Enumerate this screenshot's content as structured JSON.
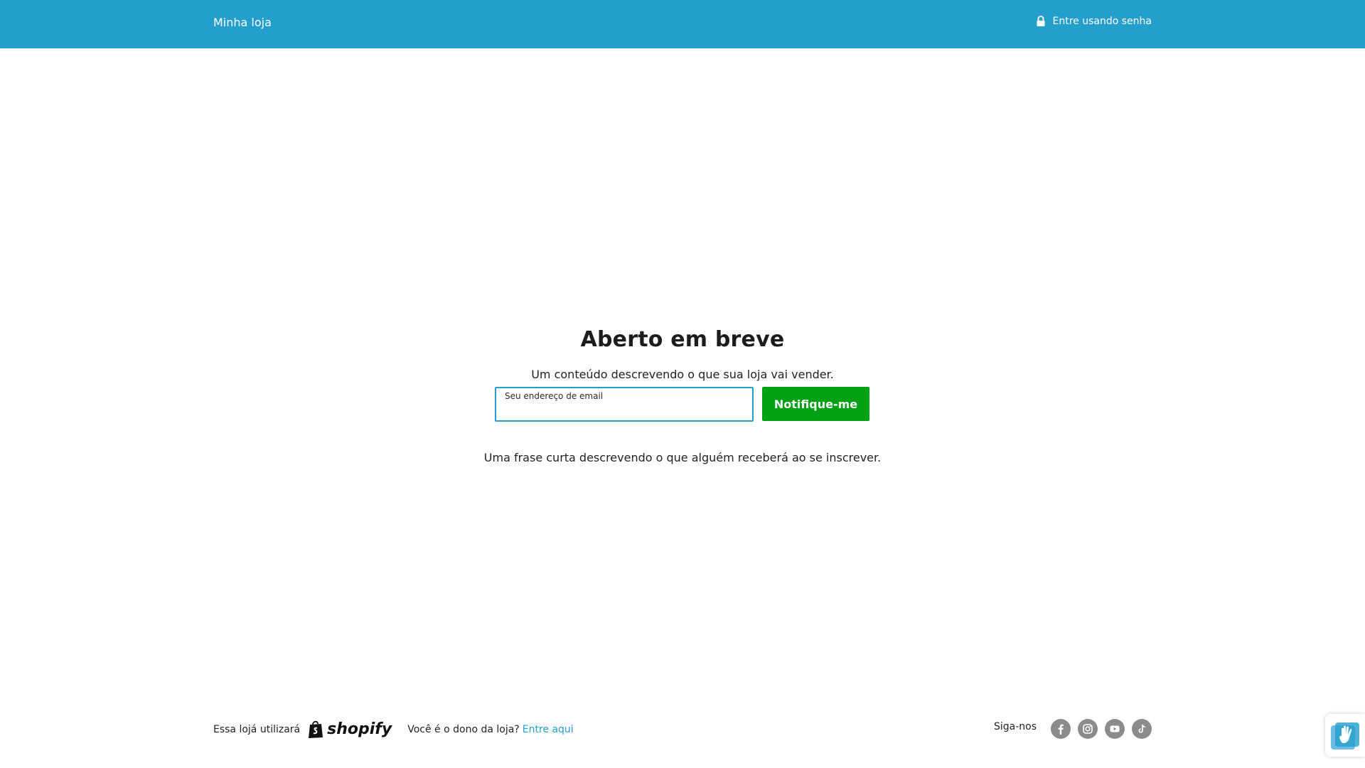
{
  "header": {
    "store_name": "Minha loja",
    "login_label": "Entre usando senha",
    "login_icon": "lock-icon"
  },
  "main": {
    "title": "Aberto em breve",
    "description": "Um conteúdo descrevendo o que sua loja vai vender.",
    "email_label": "Seu endereço de email",
    "email_value": "",
    "notify_label": "Notifique-me",
    "subtext": "Uma frase curta descrevendo o que alguém receberá ao se inscrever."
  },
  "footer": {
    "powered_by": "Essa lojá utilizará",
    "shopify_brand": "shopify",
    "owner_question": "Você é o dono da loja?",
    "owner_link": "Entre aqui",
    "follow_label": "Siga-nos",
    "social": [
      "facebook-icon",
      "instagram-icon",
      "youtube-icon",
      "tiktok-icon"
    ]
  },
  "colors": {
    "header_bg": "#249fcb",
    "button_bg": "#00a113",
    "link": "#249fcb",
    "social_bg": "#8c8c8c"
  }
}
